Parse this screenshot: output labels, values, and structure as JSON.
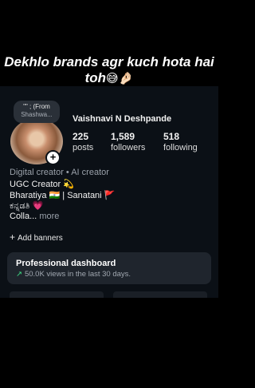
{
  "caption": {
    "text": "Dekhlo brands agr kuch hota hai toh",
    "emoji": "😅🤌🏻"
  },
  "note": {
    "line1": "\"\" ; (From",
    "line2": "Shashwa..."
  },
  "profile": {
    "name": "Vaishnavi N Deshpande"
  },
  "stats": [
    {
      "value": "225",
      "label": "posts"
    },
    {
      "value": "1,589",
      "label": "followers"
    },
    {
      "value": "518",
      "label": "following"
    }
  ],
  "category": "Digital creator • AI creator",
  "bio": {
    "line1": "UGC Creator 💫",
    "line2": "Bharatiya 🇮🇳 | Sanatani 🚩",
    "line3": "ಕನ್ನಡತಿ 💗",
    "line4": "Colla...",
    "more": "more"
  },
  "add_banners": "Add banners",
  "professional_dashboard": {
    "title": "Professional dashboard",
    "subtitle": "50.0K views in the last 30 days."
  }
}
